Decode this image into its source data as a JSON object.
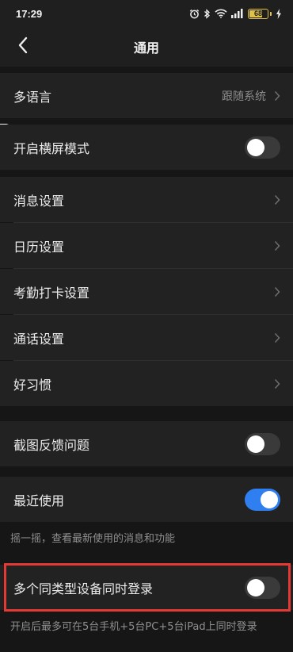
{
  "status_bar": {
    "time": "17:29",
    "battery_level": "68",
    "battery_fraction": 0.68,
    "battery_color": "#e0c248",
    "icons": [
      "alarm-icon",
      "bluetooth-icon",
      "wifi-icon",
      "cellular-signal-icon",
      "battery-icon",
      "charging-icon"
    ]
  },
  "nav": {
    "title": "通用",
    "back_icon": "back-arrow-icon"
  },
  "settings": {
    "language": {
      "label": "多语言",
      "value": "跟随系统"
    },
    "landscape": {
      "label": "开启横屏模式",
      "enabled": false
    },
    "messages": {
      "label": "消息设置"
    },
    "calendar": {
      "label": "日历设置"
    },
    "attendance": {
      "label": "考勤打卡设置"
    },
    "calls": {
      "label": "通话设置"
    },
    "habits": {
      "label": "好习惯"
    },
    "screenshot_feedback": {
      "label": "截图反馈问题",
      "enabled": false
    },
    "recent": {
      "label": "最近使用",
      "enabled": true,
      "hint": "摇一摇，查看最新使用的消息和功能"
    },
    "multi_device": {
      "label": "多个同类型设备同时登录",
      "enabled": false,
      "hint": "开启后最多可在5台手机+5台PC+5台iPad上同时登录"
    }
  },
  "colors": {
    "toggle_on": "#2f7ff0",
    "toggle_off": "#3a3a3a",
    "highlight": "#e53935",
    "background": "#161616",
    "row_background": "#222222"
  }
}
